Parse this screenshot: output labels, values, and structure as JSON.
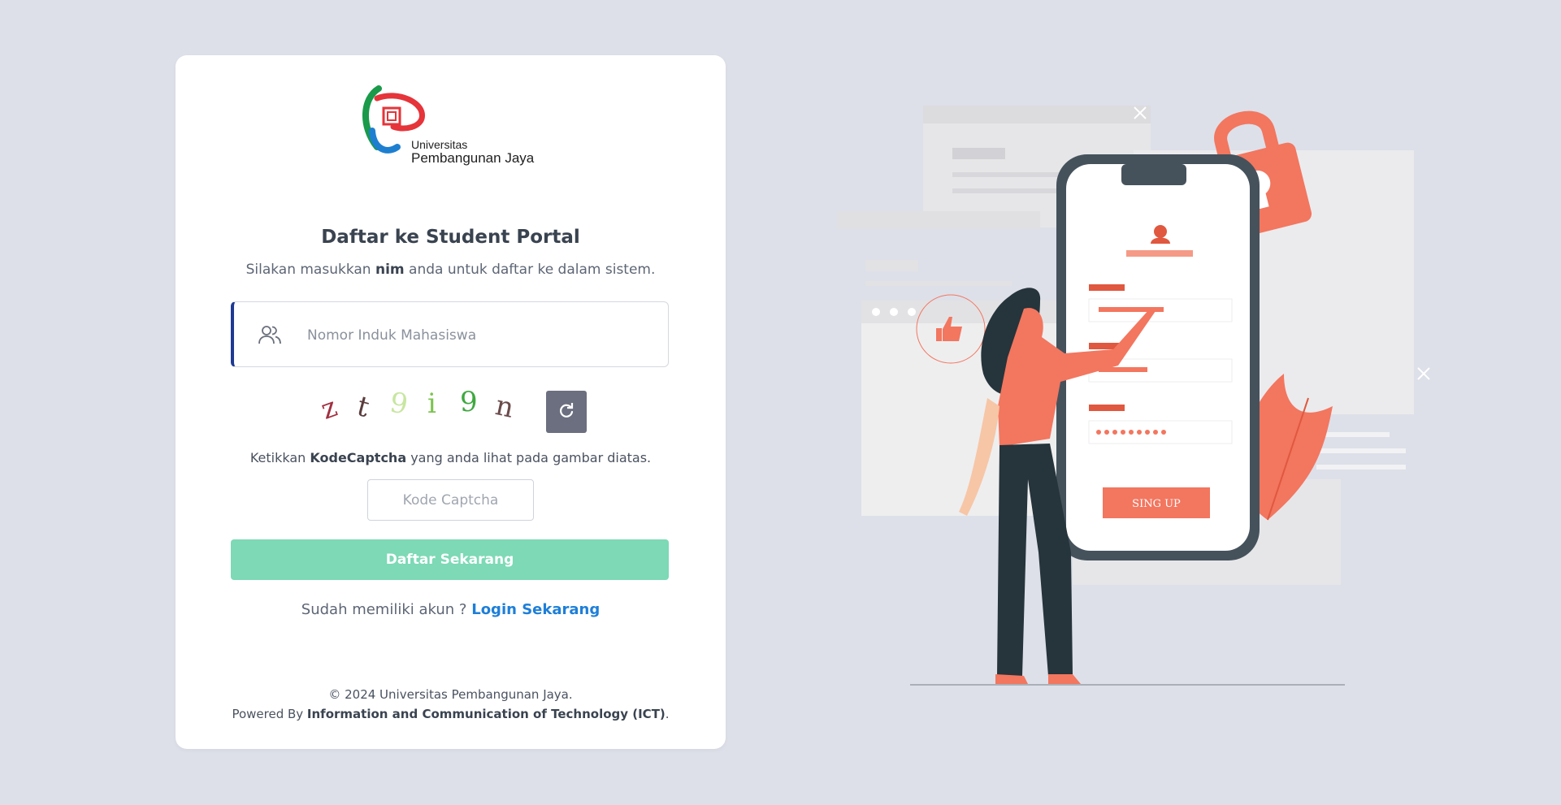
{
  "logo": {
    "line1": "Universitas",
    "line2": "Pembangunan Jaya"
  },
  "heading": {
    "title": "Daftar ke Student Portal"
  },
  "subtitle": {
    "prefix": "Silakan masukkan ",
    "bold": "nim",
    "suffix": " anda untuk daftar ke dalam sistem."
  },
  "nim_field": {
    "placeholder": "Nomor Induk Mahasiswa",
    "icon": "users-icon"
  },
  "captcha": {
    "chars": [
      {
        "char": "z",
        "color": "#a03040"
      },
      {
        "char": "t",
        "color": "#5a3c3c"
      },
      {
        "char": "9",
        "color": "#c8e6a0"
      },
      {
        "char": "i",
        "color": "#7cc450"
      },
      {
        "char": "9",
        "color": "#3fa83f"
      },
      {
        "char": "n",
        "color": "#6b4a4a"
      }
    ],
    "refresh_icon": "refresh-icon"
  },
  "hint": {
    "prefix": "Ketikkan ",
    "bold": "KodeCaptcha",
    "suffix": " yang anda lihat pada gambar diatas."
  },
  "captcha_input": {
    "placeholder": "Kode Captcha"
  },
  "submit": {
    "label": "Daftar Sekarang",
    "color": "#7dd9b6"
  },
  "login_row": {
    "text": "Sudah memiliki akun ? ",
    "link": "Login Sekarang"
  },
  "footer": {
    "line1": "© 2024 Universitas Pembangunan Jaya.",
    "line2_prefix": "Powered By ",
    "line2_bold": "Information and Communication of Technology (ICT)",
    "line2_suffix": "."
  },
  "illustration": {
    "button_label": "SING UP"
  },
  "colors": {
    "background": "#dde0e9",
    "accent": "#1f3a93",
    "link": "#1e7fd8",
    "illustration": "#f3765f"
  }
}
